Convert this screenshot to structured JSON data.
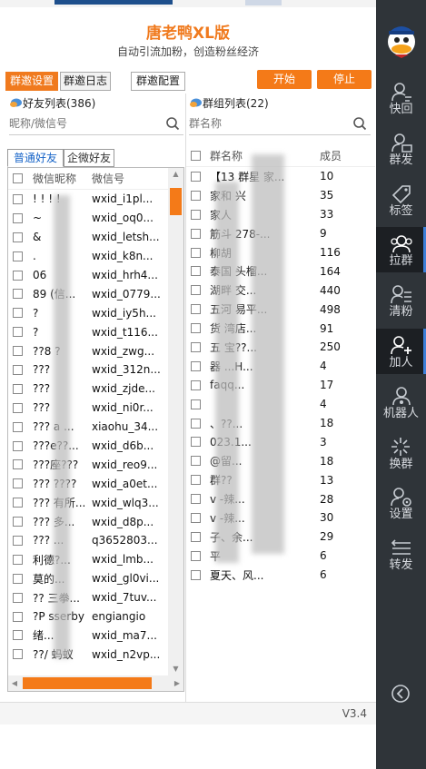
{
  "app": {
    "title": "唐老鸭XL版",
    "subtitle": "自动引流加粉，创造粉丝经济",
    "version": "V3.4"
  },
  "toolbar": {
    "tabs": [
      "群邀设置",
      "群邀日志",
      "群邀配置"
    ],
    "start_label": "开始",
    "stop_label": "停止"
  },
  "friends": {
    "title": "好友列表(386)",
    "search_placeholder": "昵称/微信号",
    "subtabs": [
      "普通好友",
      "企微好友"
    ],
    "col_nick": "微信昵称",
    "col_wxid": "微信号",
    "rows": [
      {
        "nick": "! ! ! !",
        "wxid": "wxid_i1pl..."
      },
      {
        "nick": "~",
        "wxid": "wxid_oq0..."
      },
      {
        "nick": "&",
        "wxid": "wxid_letsh..."
      },
      {
        "nick": ".",
        "wxid": "wxid_k8n..."
      },
      {
        "nick": "06",
        "wxid": "wxid_hrh4..."
      },
      {
        "nick": "89  (信...",
        "wxid": "wxid_0779..."
      },
      {
        "nick": "?",
        "wxid": "wxid_iy5h..."
      },
      {
        "nick": "?",
        "wxid": "wxid_t116..."
      },
      {
        "nick": "??8 ?",
        "wxid": "wxid_zwg..."
      },
      {
        "nick": "???",
        "wxid": "wxid_312n..."
      },
      {
        "nick": "???",
        "wxid": "wxid_zjde..."
      },
      {
        "nick": "???",
        "wxid": "wxid_ni0r..."
      },
      {
        "nick": "??? a ...",
        "wxid": "xiaohu_34..."
      },
      {
        "nick": "???e??...",
        "wxid": "wxid_d6b..."
      },
      {
        "nick": "???座???",
        "wxid": "wxid_reo9..."
      },
      {
        "nick": "??? ????",
        "wxid": "wxid_a0et..."
      },
      {
        "nick": "??? 有所...",
        "wxid": "wxid_wlq3..."
      },
      {
        "nick": "??? 多...",
        "wxid": "wxid_d8p..."
      },
      {
        "nick": "??? ...",
        "wxid": "q3652803..."
      },
      {
        "nick": "  利德?...",
        "wxid": "wxid_lmb..."
      },
      {
        "nick": "  莫的...",
        "wxid": "wxid_gl0vi..."
      },
      {
        "nick": "?? 三拳...",
        "wxid": "wxid_7tuv..."
      },
      {
        "nick": "?P sserby",
        "wxid": "engiangio"
      },
      {
        "nick": "  绪...",
        "wxid": "wxid_ma7..."
      },
      {
        "nick": "??/ 蚂蚁",
        "wxid": "wxid_n2vp..."
      }
    ]
  },
  "groups": {
    "title": "群组列表(22)",
    "search_placeholder": "群名称",
    "col_name": "群名称",
    "col_members": "成员",
    "rows": [
      {
        "name": "【13 群星 家...",
        "members": "10"
      },
      {
        "name": "家和 兴",
        "members": "35"
      },
      {
        "name": "家人",
        "members": "33"
      },
      {
        "name": "筋斗 278-...",
        "members": "9"
      },
      {
        "name": "柳胡",
        "members": "116"
      },
      {
        "name": "泰国 头榴...",
        "members": "164"
      },
      {
        "name": "湖畔 交...",
        "members": "440"
      },
      {
        "name": "五河 易平...",
        "members": "498"
      },
      {
        "name": " 货 湾店...",
        "members": "91"
      },
      {
        "name": " 五 宝??...",
        "members": "250"
      },
      {
        "name": "  器 ...H...",
        "members": "4"
      },
      {
        "name": "  faqq...",
        "members": "17"
      },
      {
        "name": "  ",
        "members": "4"
      },
      {
        "name": "  、??...",
        "members": "18"
      },
      {
        "name": "  023.1...",
        "members": "3"
      },
      {
        "name": "  @留...",
        "members": "18"
      },
      {
        "name": "  群??",
        "members": "13"
      },
      {
        "name": "v  -辣...",
        "members": "28"
      },
      {
        "name": "v  -辣...",
        "members": "30"
      },
      {
        "name": "  子、余...",
        "members": "29"
      },
      {
        "name": "  平",
        "members": "6"
      },
      {
        "name": "  夏天、风...",
        "members": "6"
      }
    ]
  },
  "sidebar": {
    "items": [
      {
        "label": "快回",
        "icon": "person-chat-icon"
      },
      {
        "label": "群发",
        "icon": "person-send-icon"
      },
      {
        "label": "标签",
        "icon": "tag-icon"
      },
      {
        "label": "拉群",
        "icon": "group-icon"
      },
      {
        "label": "清粉",
        "icon": "person-list-icon"
      },
      {
        "label": "加人",
        "icon": "person-add-icon"
      },
      {
        "label": "机器人",
        "icon": "robot-icon"
      },
      {
        "label": "换群",
        "icon": "sparkle-icon"
      },
      {
        "label": "设置",
        "icon": "person-gear-icon"
      },
      {
        "label": "转发",
        "icon": "forward-icon"
      }
    ],
    "accent": "#3d7fd8"
  }
}
